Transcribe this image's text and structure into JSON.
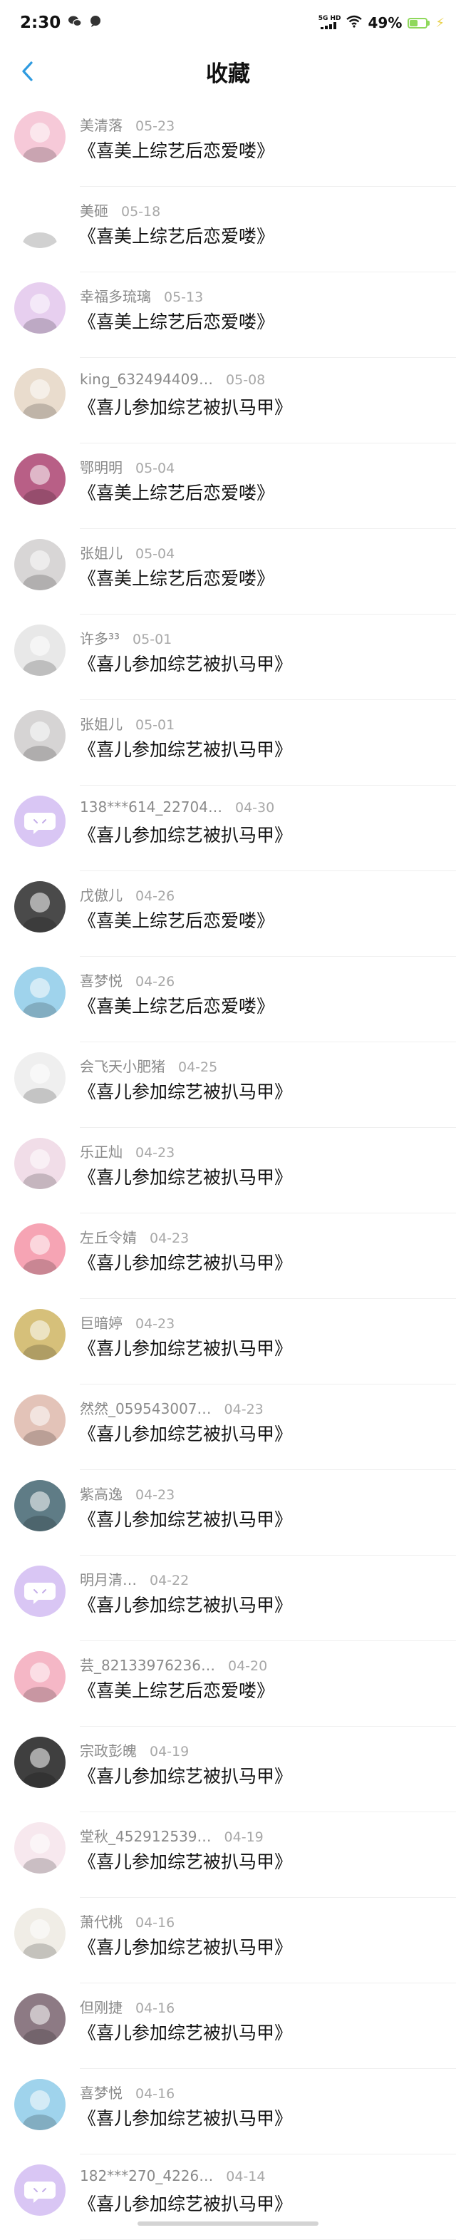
{
  "status": {
    "time": "2:30",
    "net_label_top": "5G HD",
    "battery": "49%",
    "battery_level": 0.49
  },
  "header": {
    "title": "收藏"
  },
  "items": [
    {
      "user": "美清落",
      "date": "05-23",
      "content": "《喜美上综艺后恋爱喽》",
      "avatar_color": "#f6c9d8"
    },
    {
      "user": "美砸",
      "date": "05-18",
      "content": "《喜美上综艺后恋爱喽》",
      "avatar_color": "#ffffff"
    },
    {
      "user": "幸福多琉璃",
      "date": "05-13",
      "content": "《喜美上综艺后恋爱喽》",
      "avatar_color": "#e7cfef"
    },
    {
      "user": "king_632494409…",
      "date": "05-08",
      "content": "《喜儿参加综艺被扒马甲》",
      "avatar_color": "#e9dccd"
    },
    {
      "user": "鄂明明",
      "date": "05-04",
      "content": "《喜美上综艺后恋爱喽》",
      "avatar_color": "#b85f86"
    },
    {
      "user": "张姐儿",
      "date": "05-04",
      "content": "《喜美上综艺后恋爱喽》",
      "avatar_color": "#d8d6d6"
    },
    {
      "user": "许多³³",
      "date": "05-01",
      "content": "《喜儿参加综艺被扒马甲》",
      "avatar_color": "#e8e8e8"
    },
    {
      "user": "张姐儿",
      "date": "05-01",
      "content": "《喜儿参加综艺被扒马甲》",
      "avatar_color": "#d6d4d4"
    },
    {
      "user": "138***614_22704…",
      "date": "04-30",
      "content": "《喜儿参加综艺被扒马甲》",
      "avatar_color": "#d9c6f4"
    },
    {
      "user": "戊傲儿",
      "date": "04-26",
      "content": "《喜美上综艺后恋爱喽》",
      "avatar_color": "#4a4a4a"
    },
    {
      "user": "喜梦悦",
      "date": "04-26",
      "content": "《喜美上综艺后恋爱喽》",
      "avatar_color": "#9fd3ec"
    },
    {
      "user": "会飞天小肥猪",
      "date": "04-25",
      "content": "《喜儿参加综艺被扒马甲》",
      "avatar_color": "#efefef"
    },
    {
      "user": "乐正灿",
      "date": "04-23",
      "content": "《喜儿参加综艺被扒马甲》",
      "avatar_color": "#f1dde8"
    },
    {
      "user": "左丘令婧",
      "date": "04-23",
      "content": "《喜儿参加综艺被扒马甲》",
      "avatar_color": "#f6a4b4"
    },
    {
      "user": "巨暗婷",
      "date": "04-23",
      "content": "《喜儿参加综艺被扒马甲》",
      "avatar_color": "#d6c07a"
    },
    {
      "user": "然然_059543007…",
      "date": "04-23",
      "content": "《喜儿参加综艺被扒马甲》",
      "avatar_color": "#e3c3b8"
    },
    {
      "user": "紫高逸",
      "date": "04-23",
      "content": "《喜儿参加综艺被扒马甲》",
      "avatar_color": "#5f7c86"
    },
    {
      "user": "明月清…",
      "date": "04-22",
      "content": "《喜儿参加综艺被扒马甲》",
      "avatar_color": "#d9c6f4"
    },
    {
      "user": "芸_82133976236…",
      "date": "04-20",
      "content": "《喜美上综艺后恋爱喽》",
      "avatar_color": "#f5b7c6"
    },
    {
      "user": "宗政彭魄",
      "date": "04-19",
      "content": "《喜儿参加综艺被扒马甲》",
      "avatar_color": "#3f3f3f"
    },
    {
      "user": "堂秋_452912539…",
      "date": "04-19",
      "content": "《喜儿参加综艺被扒马甲》",
      "avatar_color": "#f7e8ee"
    },
    {
      "user": "萧代桃",
      "date": "04-16",
      "content": "《喜儿参加综艺被扒马甲》",
      "avatar_color": "#f0ede6"
    },
    {
      "user": "但刚捷",
      "date": "04-16",
      "content": "《喜儿参加综艺被扒马甲》",
      "avatar_color": "#8d7a84"
    },
    {
      "user": "喜梦悦",
      "date": "04-16",
      "content": "《喜儿参加综艺被扒马甲》",
      "avatar_color": "#9fd3ec"
    },
    {
      "user": "182***270_4226…",
      "date": "04-14",
      "content": "《喜儿参加综艺被扒马甲》",
      "avatar_color": "#d9c6f4"
    }
  ],
  "icons": {
    "back": "chevron-left-icon",
    "placeholder_avatar": "chat-bubble-icon",
    "wifi": "wifi-icon",
    "battery": "battery-icon"
  },
  "colors": {
    "accent": "#2f9be0",
    "placeholder_avatar_bg": "#d9c6f4"
  }
}
